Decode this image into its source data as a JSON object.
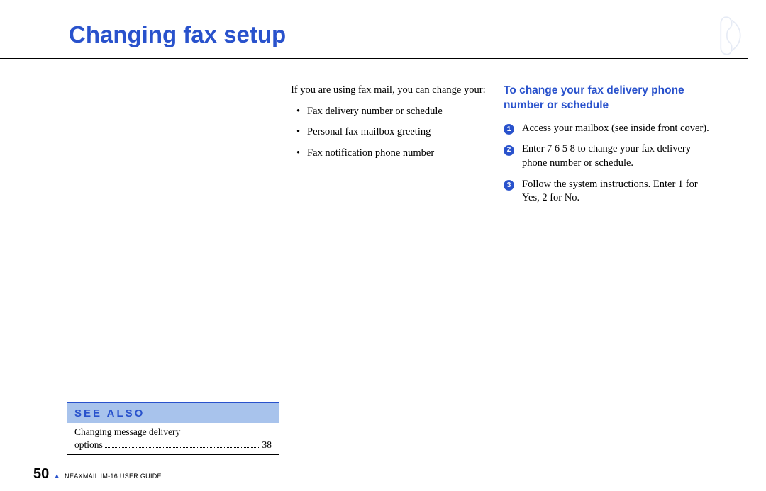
{
  "header": {
    "title": "Changing fax setup"
  },
  "content": {
    "intro": "If you are using fax mail, you can change your:",
    "bullets": [
      "Fax delivery number or schedule",
      "Personal fax mailbox greeting",
      "Fax notification phone number"
    ],
    "sub_heading": "To change your fax delivery phone number or schedule",
    "steps": [
      {
        "num": "1",
        "text": "Access your mailbox (see inside front cover)."
      },
      {
        "num": "2",
        "text": "Enter 7 6 5 8 to change your fax delivery phone number or schedule."
      },
      {
        "num": "3",
        "text": "Follow the system instructions. Enter 1 for Yes, 2 for No."
      }
    ]
  },
  "see_also": {
    "heading": "SEE ALSO",
    "ref_text_line1": "Changing message delivery",
    "ref_text_line2": "options",
    "ref_page": "38"
  },
  "footer": {
    "page": "50",
    "guide": "NEAXMAIL IM-16 USER GUIDE"
  }
}
